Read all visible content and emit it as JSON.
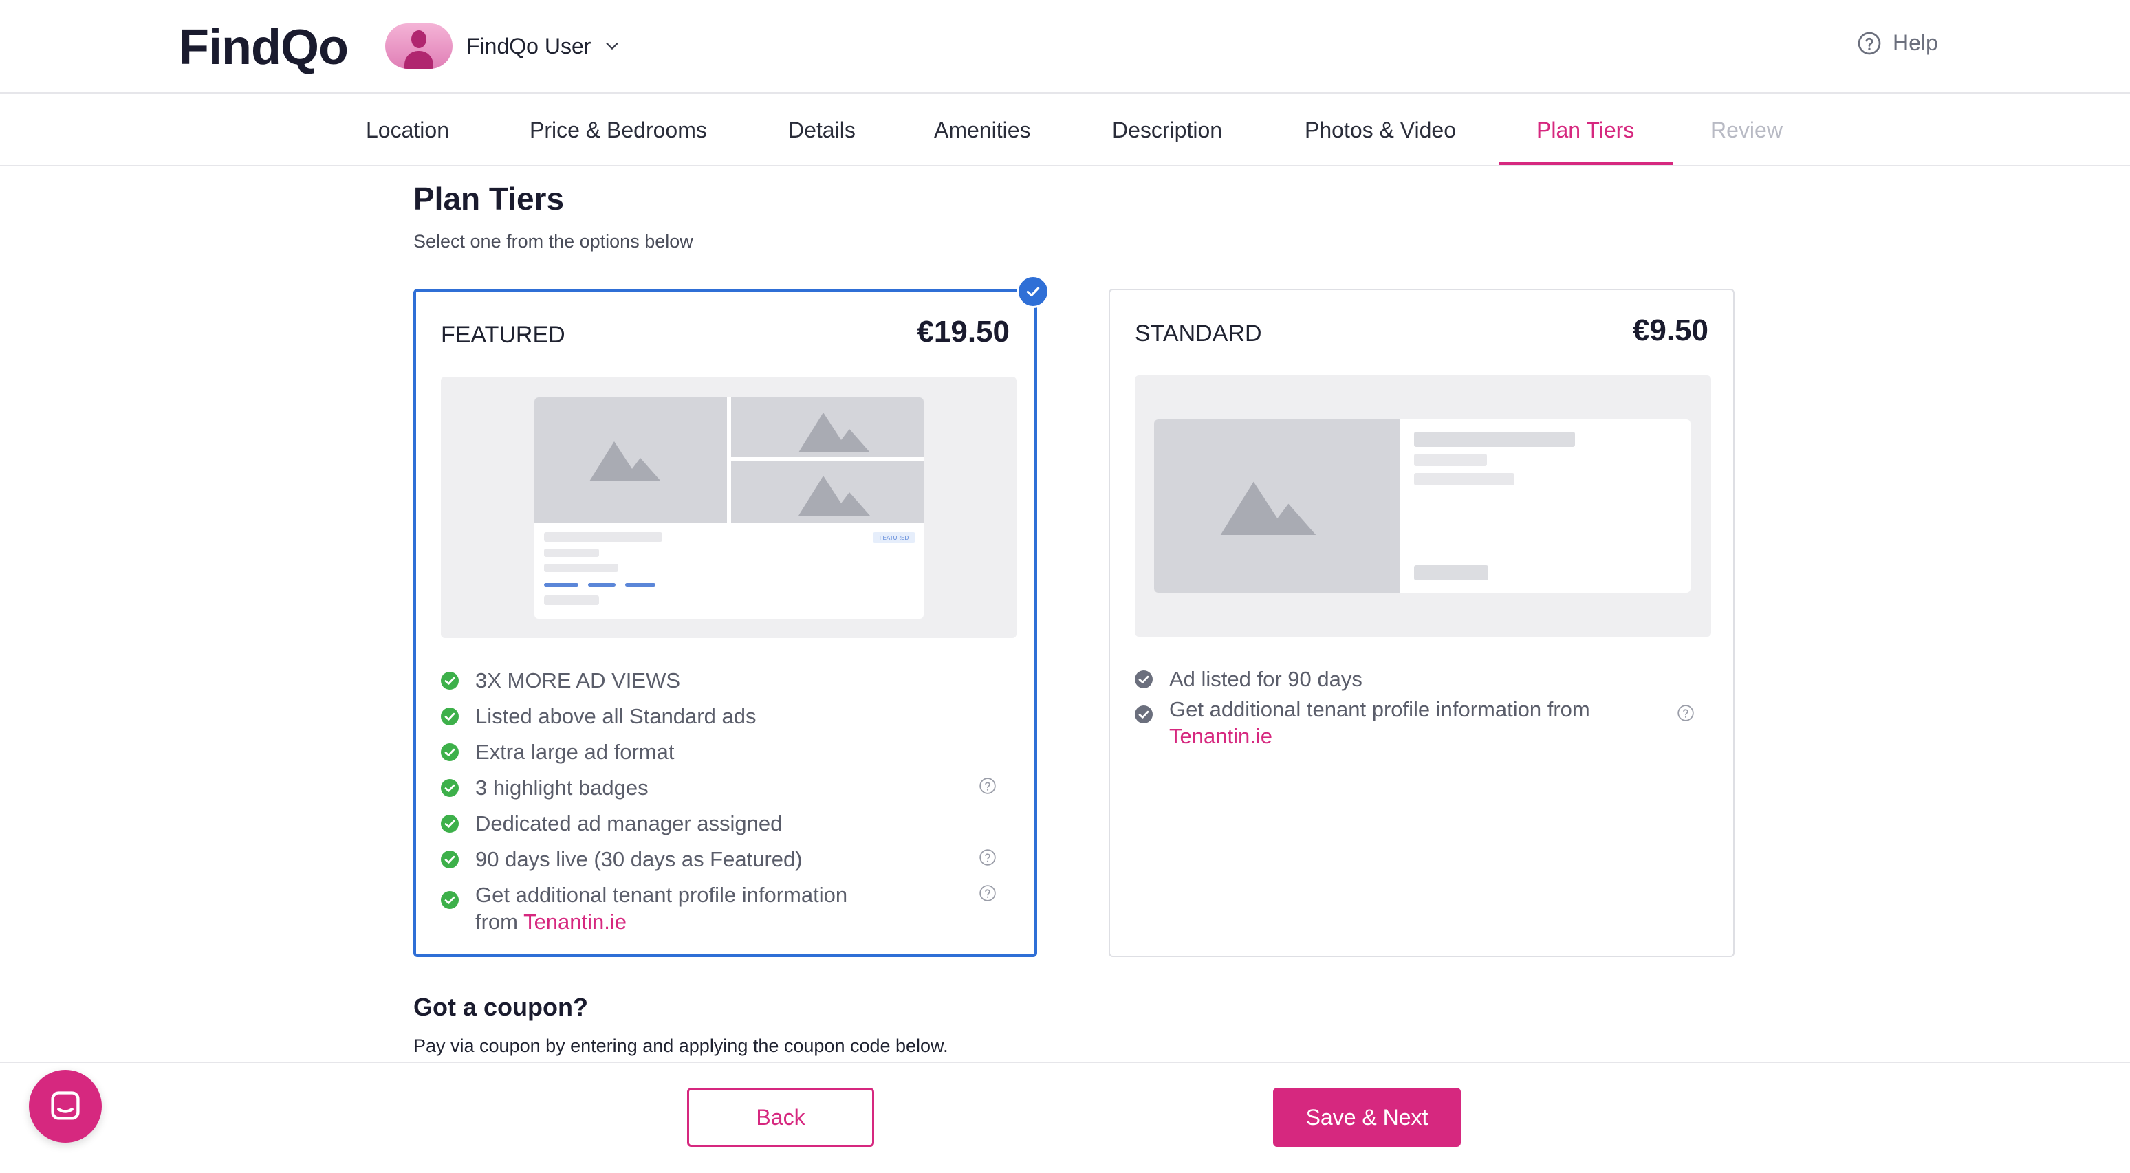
{
  "header": {
    "logo": "FindQo",
    "user_name": "FindQo User",
    "help_label": "Help"
  },
  "tabs": [
    {
      "label": "Location",
      "state": "done"
    },
    {
      "label": "Price & Bedrooms",
      "state": "done"
    },
    {
      "label": "Details",
      "state": "done"
    },
    {
      "label": "Amenities",
      "state": "done"
    },
    {
      "label": "Description",
      "state": "done"
    },
    {
      "label": "Photos & Video",
      "state": "done"
    },
    {
      "label": "Plan Tiers",
      "state": "active"
    },
    {
      "label": "Review",
      "state": "disabled"
    }
  ],
  "main": {
    "title": "Plan Tiers",
    "subtitle": "Select one from the options below",
    "plans": [
      {
        "name": "FEATURED",
        "price": "€19.50",
        "selected": true,
        "preview_badge": "FEATURED",
        "features": [
          {
            "text": "3X MORE AD VIEWS",
            "help": false
          },
          {
            "text": "Listed above all Standard ads",
            "help": false
          },
          {
            "text": "Extra large ad format",
            "help": false
          },
          {
            "text": "3 highlight badges",
            "help": true
          },
          {
            "text": "Dedicated ad manager assigned",
            "help": false
          },
          {
            "text": "90 days live (30 days as Featured)",
            "help": true
          },
          {
            "text_line1": "Get additional tenant profile information",
            "text_line2_prefix": "from ",
            "link": "Tenantin.ie",
            "help": true
          }
        ]
      },
      {
        "name": "STANDARD",
        "price": "€9.50",
        "selected": false,
        "features": [
          {
            "text": "Ad listed for 90 days",
            "help": false
          },
          {
            "text_line1": "Get additional tenant profile information from",
            "link": "Tenantin.ie",
            "help": true
          }
        ]
      }
    ],
    "coupon": {
      "title": "Got a coupon?",
      "subtitle": "Pay via coupon by entering and applying the coupon code below."
    }
  },
  "footer": {
    "back_label": "Back",
    "next_label": "Save & Next"
  },
  "colors": {
    "accent": "#d6287f",
    "selected_border": "#2f6fd6",
    "check_green": "#3db04a",
    "check_grey": "#6b6f7d"
  },
  "icons": {
    "help": "question-circle-icon",
    "feature_featured": "green-check-circle-icon",
    "feature_standard": "grey-check-circle-icon",
    "selected": "blue-check-badge-icon",
    "chat": "chat-bubble-icon"
  }
}
